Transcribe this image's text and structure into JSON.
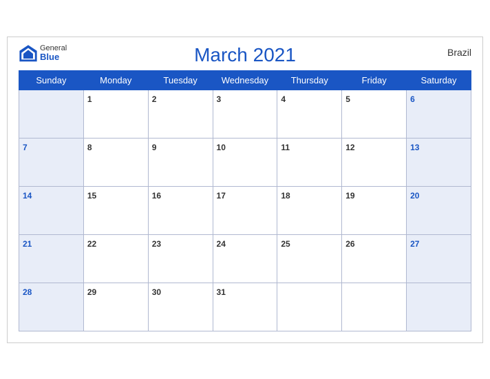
{
  "header": {
    "title": "March 2021",
    "country": "Brazil",
    "logo_general": "General",
    "logo_blue": "Blue"
  },
  "weekdays": [
    "Sunday",
    "Monday",
    "Tuesday",
    "Wednesday",
    "Thursday",
    "Friday",
    "Saturday"
  ],
  "weeks": [
    [
      null,
      1,
      2,
      3,
      4,
      5,
      6
    ],
    [
      7,
      8,
      9,
      10,
      11,
      12,
      13
    ],
    [
      14,
      15,
      16,
      17,
      18,
      19,
      20
    ],
    [
      21,
      22,
      23,
      24,
      25,
      26,
      27
    ],
    [
      28,
      29,
      30,
      31,
      null,
      null,
      null
    ]
  ]
}
